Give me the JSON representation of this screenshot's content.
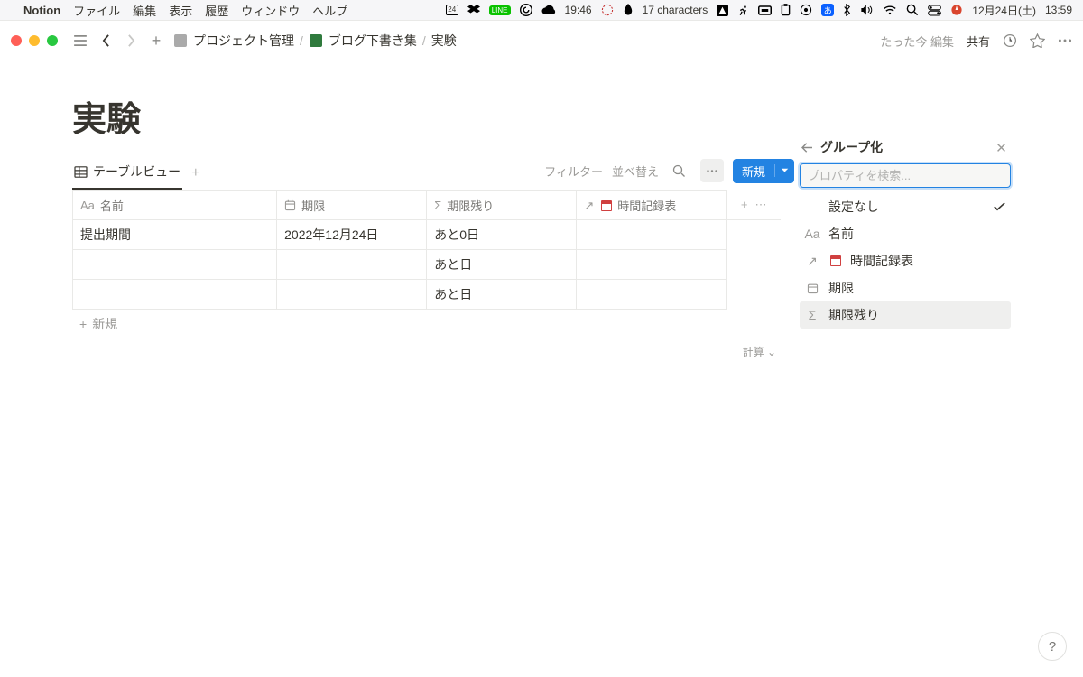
{
  "menubar": {
    "app": "Notion",
    "items": [
      "ファイル",
      "編集",
      "表示",
      "履歴",
      "ウィンドウ",
      "ヘルプ"
    ],
    "calendar_day": "24",
    "center_time": "19:46",
    "char_count": "17 characters",
    "ime": "あ",
    "date": "12月24日(土)",
    "clock": "13:59"
  },
  "topbar": {
    "breadcrumbs": [
      "プロジェクト管理",
      "ブログ下書き集",
      "実験"
    ],
    "edit_status": "たった今 編集",
    "share": "共有"
  },
  "page": {
    "title": "実験",
    "view_tab": "テーブルビュー",
    "filter": "フィルター",
    "sort": "並べ替え",
    "new_btn": "新規"
  },
  "table": {
    "headers": {
      "name": "名前",
      "date": "期限",
      "remain": "期限残り",
      "time": "時間記録表"
    },
    "rows": [
      {
        "name": "提出期間",
        "date": "2022年12月24日",
        "remain": "あと0日",
        "time": ""
      },
      {
        "name": "",
        "date": "",
        "remain": "あと日",
        "time": ""
      },
      {
        "name": "",
        "date": "",
        "remain": "あと日",
        "time": ""
      }
    ],
    "new_row": "新規",
    "calc": "計算"
  },
  "panel": {
    "title": "グループ化",
    "search_placeholder": "プロパティを検索...",
    "items": [
      {
        "icon": "none",
        "label": "設定なし",
        "checked": true,
        "hover": false
      },
      {
        "icon": "aa",
        "label": "名前",
        "checked": false,
        "hover": false
      },
      {
        "icon": "relation",
        "label": "時間記録表",
        "checked": false,
        "hover": false
      },
      {
        "icon": "date",
        "label": "期限",
        "checked": false,
        "hover": false
      },
      {
        "icon": "formula",
        "label": "期限残り",
        "checked": false,
        "hover": true
      }
    ]
  },
  "help": "?"
}
